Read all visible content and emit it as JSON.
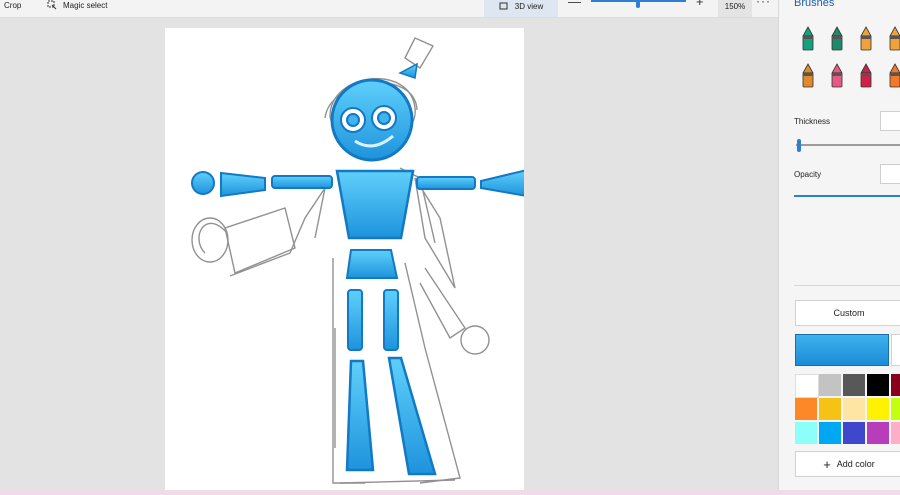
{
  "toolbar": {
    "crop_label": "Crop",
    "magic_select_label": "Magic select",
    "view_3d_label": "3D view",
    "zoom_minus": "—",
    "zoom_plus": "+",
    "zoom_level": "150%",
    "more": "···"
  },
  "panel": {
    "title": "Brushes",
    "brushes": [
      {
        "name": "marker-brush",
        "color": "#14a37f"
      },
      {
        "name": "calligraphy-pen-brush",
        "color": "#1d8a6c"
      },
      {
        "name": "oil-brush",
        "color": "#f0a23a"
      },
      {
        "name": "watercolor-brush",
        "color": "#f0a23a"
      },
      {
        "name": "pencil-brush",
        "color": "#e08a2a"
      },
      {
        "name": "eraser-brush",
        "color": "#e75a86"
      },
      {
        "name": "crayon-brush",
        "color": "#d11f4a"
      },
      {
        "name": "spray-can-brush",
        "color": "#f07a2a"
      }
    ],
    "thickness_label": "Thickness",
    "opacity_label": "Opacity",
    "custom_label": "Custom",
    "current_color": "#29a1e8",
    "add_color_label": "Add color",
    "swatches": [
      [
        "#ffffff",
        "#c3c3c3",
        "#585858",
        "#000000",
        "#88001b"
      ],
      [
        "#fd8827",
        "#f5c216",
        "#fde6a3",
        "#fff200",
        "#c4ff0e"
      ],
      [
        "#8cfffb",
        "#00a8f3",
        "#3f48cc",
        "#b83dba",
        "#ffaec8"
      ]
    ]
  }
}
